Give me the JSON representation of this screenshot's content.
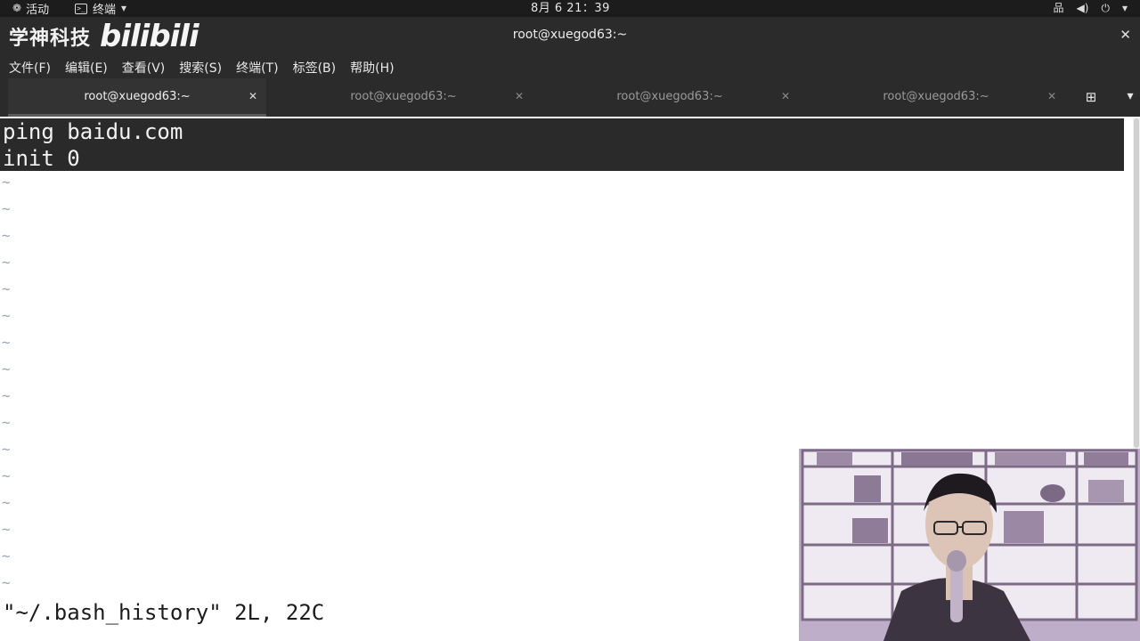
{
  "topbar": {
    "activities": "活动",
    "app_menu": "终端",
    "clock": "8月 6  21：39",
    "icons": [
      "network-icon",
      "volume-icon",
      "power-icon"
    ]
  },
  "window": {
    "brand_cn": "学神科技",
    "brand_logo": "bilibili",
    "title": "root@xuegod63:~"
  },
  "menu": [
    "文件(F)",
    "编辑(E)",
    "查看(V)",
    "搜索(S)",
    "终端(T)",
    "标签(B)",
    "帮助(H)"
  ],
  "tabs": [
    {
      "label": "root@xuegod63:~",
      "active": true
    },
    {
      "label": "root@xuegod63:~",
      "active": false
    },
    {
      "label": "root@xuegod63:~",
      "active": false
    },
    {
      "label": "root@xuegod63:~",
      "active": false
    }
  ],
  "editor": {
    "lines": [
      "ping baidu.com",
      "init 0"
    ],
    "empty_line_marker": "~",
    "status_line": "\"~/.bash_history\" 2L, 22C"
  },
  "colors": {
    "topbar_bg": "#1c1c1c",
    "chrome_bg": "#2b2b2b",
    "selection_bg": "#2a2a2a",
    "terminal_bg": "#ffffff",
    "tilde": "#9aa6b8"
  }
}
